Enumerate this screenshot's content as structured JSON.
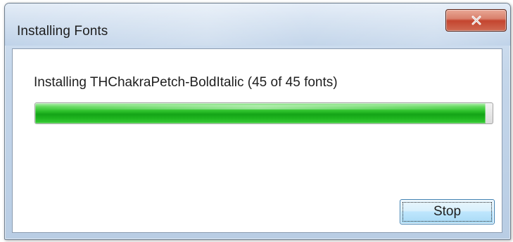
{
  "window": {
    "title": "Installing Fonts",
    "close_icon": "close-icon"
  },
  "progress": {
    "status_text": "Installing THChakraPetch-BoldItalic (45 of 45 fonts)",
    "current": 45,
    "total": 45,
    "fill_fraction": 0.985,
    "fill_color": "#14a417"
  },
  "buttons": {
    "stop_label": "Stop"
  },
  "colors": {
    "close_button": "#c4452f",
    "titlebar": "#c4d6ea"
  }
}
